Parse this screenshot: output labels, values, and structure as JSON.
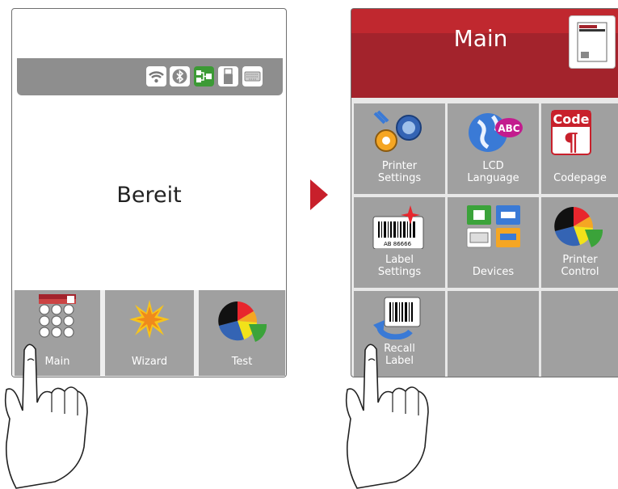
{
  "left_screen": {
    "status_icons": [
      "wifi-icon",
      "bluetooth-icon",
      "network-icon",
      "usb-icon",
      "keyboard-icon"
    ],
    "status_text": "Bereit",
    "bottom_tiles": [
      {
        "label": "Main",
        "icon": "main-grid-icon"
      },
      {
        "label": "Wizard",
        "icon": "wizard-burst-icon"
      },
      {
        "label": "Test",
        "icon": "test-pie-icon"
      }
    ]
  },
  "right_screen": {
    "title": "Main",
    "header_icon": "printer-status-icon",
    "tiles": [
      {
        "label": "Printer\nSettings",
        "icon": "gears-icon"
      },
      {
        "label": "LCD\nLanguage",
        "icon": "globe-abc-icon"
      },
      {
        "label": "Codepage",
        "icon": "code-page-icon"
      },
      {
        "label": "Label\nSettings",
        "icon": "barcode-label-icon"
      },
      {
        "label": "Devices",
        "icon": "devices-icon"
      },
      {
        "label": "Printer\nControl",
        "icon": "pie-control-icon"
      },
      {
        "label": "Recall\nLabel",
        "icon": "recall-barcode-icon"
      },
      {
        "label": "",
        "icon": ""
      },
      {
        "label": "",
        "icon": ""
      }
    ]
  },
  "barcode_text": "AB 86666",
  "code_icon_text": "Code",
  "abc_badge_text": "ABC",
  "colors": {
    "accent_red": "#c8202b",
    "header_red": "#a3232c",
    "tile_gray": "#a0a0a0"
  }
}
